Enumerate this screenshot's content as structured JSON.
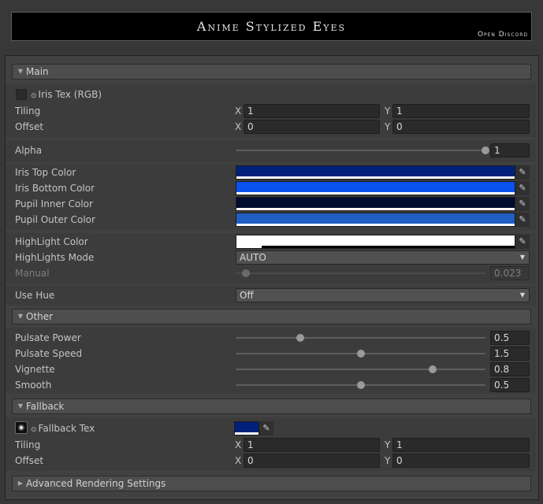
{
  "header": {
    "title": "Anime Stylized Eyes",
    "discord_link": "Open Discord"
  },
  "sections": {
    "main": "Main",
    "other": "Other",
    "fallback": "Fallback",
    "advanced": "Advanced Rendering Settings"
  },
  "main": {
    "iris_tex_label": "Iris Tex (RGB)",
    "tiling_label": "Tiling",
    "offset_label": "Offset",
    "axis_x": "X",
    "axis_y": "Y",
    "tiling_x": "1",
    "tiling_y": "1",
    "offset_x": "0",
    "offset_y": "0",
    "alpha_label": "Alpha",
    "alpha_value": "1",
    "alpha_fraction": 1.0,
    "iris_top_color_label": "Iris Top Color",
    "iris_bottom_color_label": "Iris Bottom Color",
    "pupil_inner_color_label": "Pupil Inner Color",
    "pupil_outer_color_label": "Pupil Outer Color",
    "highlight_color_label": "HighLight Color",
    "highlights_mode_label": "HighLights Mode",
    "highlights_mode_value": "AUTO",
    "manual_label": "Manual",
    "manual_value": "0.023",
    "manual_fraction": 0.023,
    "use_hue_label": "Use Hue",
    "use_hue_value": "Off"
  },
  "colors": {
    "iris_top": "#00207a",
    "iris_bottom": "#0a52f0",
    "pupil_inner": "#000d2e",
    "pupil_outer": "#1f5fc4",
    "highlight": "#ffffff",
    "fallback_tex": "#00207a"
  },
  "other": {
    "pulsate_power_label": "Pulsate Power",
    "pulsate_power_value": "0.5",
    "pulsate_power_fraction": 0.25,
    "pulsate_speed_label": "Pulsate Speed",
    "pulsate_speed_value": "1.5",
    "pulsate_speed_fraction": 0.5,
    "vignette_label": "Vignette",
    "vignette_value": "0.8",
    "vignette_fraction": 0.8,
    "smooth_label": "Smooth",
    "smooth_value": "0.5",
    "smooth_fraction": 0.5
  },
  "fallback": {
    "tex_label": "Fallback Tex",
    "tiling_label": "Tiling",
    "offset_label": "Offset",
    "axis_x": "X",
    "axis_y": "Y",
    "tiling_x": "1",
    "tiling_y": "1",
    "offset_x": "0",
    "offset_y": "0"
  },
  "icons": {
    "foldout_open": "triangle-down-icon",
    "foldout_closed": "triangle-right-icon",
    "picker": "eyedropper-icon",
    "object_field": "target-dot-icon",
    "dropdown": "chevron-down-icon"
  }
}
